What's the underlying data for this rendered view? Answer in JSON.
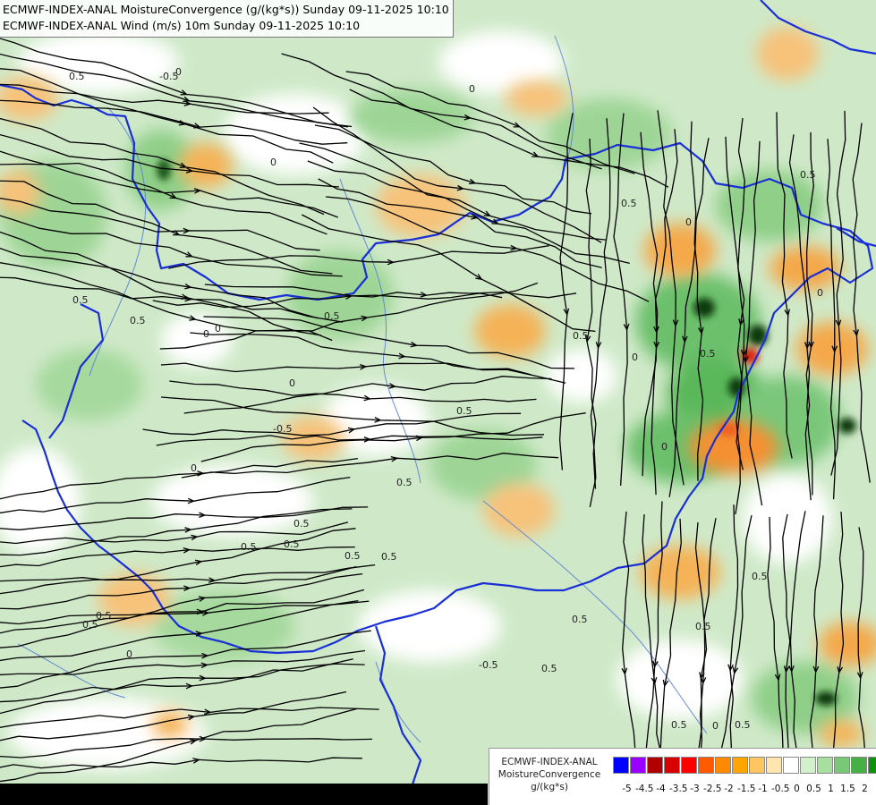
{
  "titles": {
    "line1": "ECMWF-INDEX-ANAL MoistureConvergence (g/(kg*s)) Sunday 09-11-2025 10:10",
    "line2": "ECMWF-INDEX-ANAL Wind (m/s) 10m Sunday 09-11-2025 10:10"
  },
  "legend": {
    "model": "ECMWF-INDEX-ANAL",
    "parameter": "MoistureConvergence",
    "unit": "g/(kg*s)",
    "swatch_colors": [
      "#0000ff",
      "#9900ff",
      "#b00000",
      "#d80000",
      "#ff0000",
      "#ff5a00",
      "#ff8a00",
      "#ffa500",
      "#ffc560",
      "#ffe5b0",
      "#ffffff",
      "#d2f0cc",
      "#a8dea0",
      "#78c878",
      "#46b046",
      "#109010"
    ],
    "tick_labels": [
      "-5",
      "-4.5",
      "-4",
      "-3.5",
      "-3",
      "-2.5",
      "-2",
      "-1.5",
      "-1",
      "-0.5",
      "0",
      "0.5",
      "1",
      "1.5",
      "2"
    ]
  },
  "contour_labels": [
    "0.5",
    "0",
    "-0.5",
    "0",
    "0.5",
    "0",
    "0.5",
    "-0.5",
    "0.5",
    "0",
    "0.5",
    "0",
    "0.5",
    "0.5",
    "0",
    "0.5",
    "0.5",
    "0",
    "0.5",
    "0.5",
    "0",
    "0",
    "0.5",
    "0.5",
    "0.5",
    "0.5",
    "-0.5",
    "0.5",
    "0",
    "0.5",
    "0.5",
    "0.5",
    "0",
    "0.5",
    "0.5",
    "0.5",
    "0.5",
    "0",
    "0"
  ],
  "colors": {
    "border": "#1a2fd6",
    "river": "#5a7fd6",
    "streamline": "#000000"
  }
}
